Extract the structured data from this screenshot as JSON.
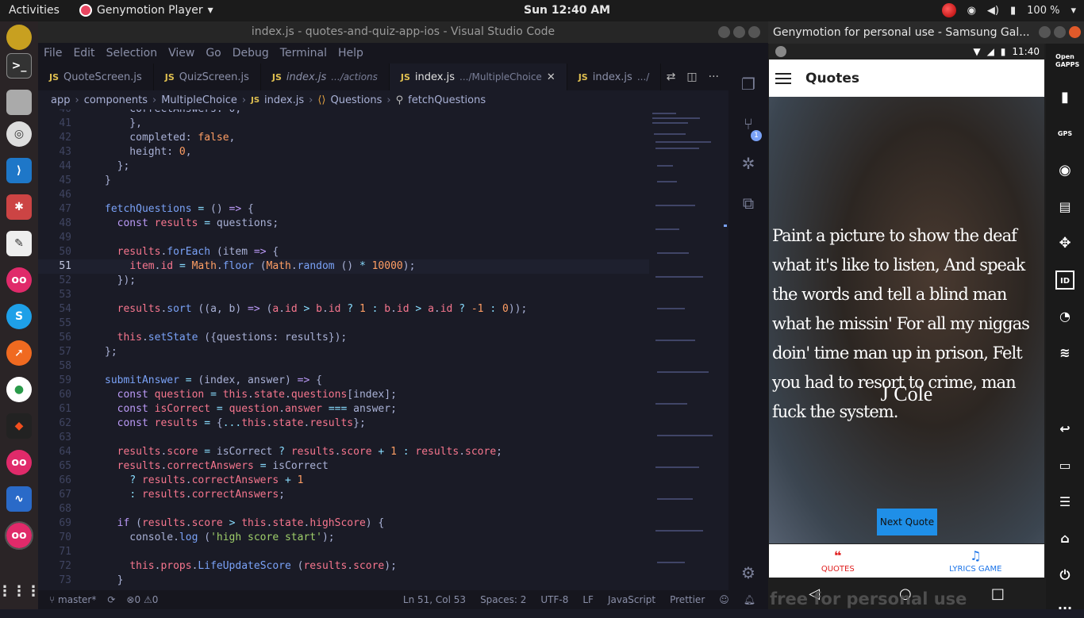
{
  "topbar": {
    "activities": "Activities",
    "app_menu": "Genymotion Player",
    "clock": "Sun 12:40 AM",
    "battery": "100 %"
  },
  "vscode": {
    "title": "index.js - quotes-and-quiz-app-ios - Visual Studio Code",
    "menu": [
      "File",
      "Edit",
      "Selection",
      "View",
      "Go",
      "Debug",
      "Terminal",
      "Help"
    ],
    "tabs": [
      {
        "name": "QuoteScreen.js",
        "hint": ""
      },
      {
        "name": "QuizScreen.js",
        "hint": ""
      },
      {
        "name": "index.js",
        "hint": ".../actions"
      },
      {
        "name": "index.js",
        "hint": ".../MultipleChoice"
      },
      {
        "name": "index.js",
        "hint": ".../"
      }
    ],
    "breadcrumb": [
      "app",
      "components",
      "MultipleChoice",
      "index.js",
      "Questions",
      "fetchQuestions"
    ],
    "status": {
      "branch": "master*",
      "problems": "0",
      "warnings": "0",
      "position": "Ln 51, Col 53",
      "spaces": "Spaces: 2",
      "encoding": "UTF-8",
      "eol": "LF",
      "language": "JavaScript",
      "formatter": "Prettier"
    },
    "scm_badge": "1"
  },
  "genymotion": {
    "title": "Genymotion for personal use - Samsung Gal...",
    "phone_time": "11:40",
    "app_title": "Quotes",
    "quote": "Paint a picture to show the deaf what it's like to listen, And speak the words and tell a blind man what he missin' For all my niggas doin' time man up in prison, Felt you had to resort to crime, man fuck the system.",
    "author": "J Cole",
    "next_button": "Next Quote",
    "nav_quotes": "QUOTES",
    "nav_lyrics": "LYRICS GAME",
    "watermark": "free for personal use",
    "side_labels": {
      "gapps": "Open GAPPS",
      "gps": "GPS",
      "id": "ID"
    }
  }
}
